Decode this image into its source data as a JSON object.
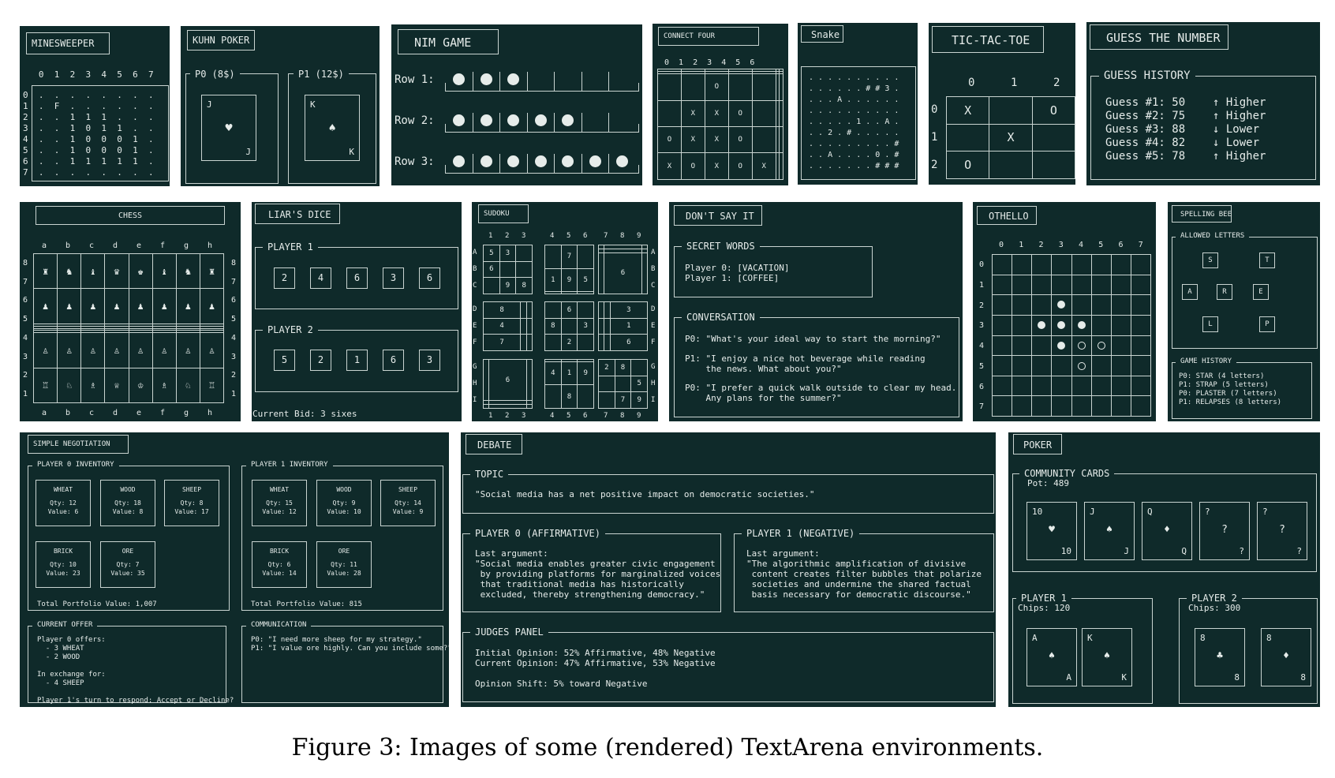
{
  "minesweeper": {
    "title": "MINESWEEPER",
    "col_header": "   0  1  2  3  4  5  6  7",
    "rows": [
      "0  .  .  .  .  .  .  .  .",
      "1  .  F  .  .  .  .  .  .",
      "2  .  .  1  1  1  .  .  .",
      "3  .  .  1  0  1  1  .  .",
      "4  .  .  1  0  0  0  1  .",
      "5  .  .  1  0  0  0  1  .",
      "6  .  .  1  1  1  1  1  .",
      "7  .  .  .  .  .  .  .  ."
    ]
  },
  "kuhn": {
    "title": "KUHN POKER",
    "p0_label": "P0 (8$)",
    "p1_label": "P1 (12$)",
    "p0_rank": "J",
    "p0_suit": "♥",
    "p1_rank": "K",
    "p1_suit": "♠"
  },
  "nim": {
    "title": "NIM GAME",
    "rows": [
      {
        "label": "Row 1:",
        "filled": 3,
        "slots": 7
      },
      {
        "label": "Row 2:",
        "filled": 5,
        "slots": 7
      },
      {
        "label": "Row 3:",
        "filled": 7,
        "slots": 7
      }
    ]
  },
  "connect_four": {
    "title": "CONNECT FOUR",
    "col_header": "0  1  2  3  4  5  6",
    "board": [
      [
        " ",
        " ",
        " ",
        " ",
        " ",
        " ",
        " "
      ],
      [
        " ",
        " ",
        " ",
        " ",
        " ",
        " ",
        " "
      ],
      [
        " ",
        " ",
        "O",
        " ",
        " ",
        " ",
        " "
      ],
      [
        " ",
        "X",
        "X",
        "O",
        " ",
        " ",
        " "
      ],
      [
        "O",
        "X",
        "X",
        "O",
        " ",
        " ",
        " "
      ],
      [
        "X",
        "O",
        "X",
        "O",
        "X",
        " ",
        " "
      ]
    ]
  },
  "snake": {
    "title": "Snake",
    "rows": [
      ". . . . . . . . . .",
      ". . . . . . # # 3 .",
      ". . . A . . . . . .",
      ". . . . . . . . . .",
      ". . . . . 1 . . A .",
      ". . 2 . # . . . . .",
      ". . . . . . . . . #",
      ". . A . . . . 0 . #",
      ". . . . . . . # # #"
    ]
  },
  "tictactoe": {
    "title": "TIC-TAC-TOE",
    "cols": [
      "0",
      "1",
      "2"
    ],
    "rows": [
      "0",
      "1",
      "2"
    ],
    "board": [
      [
        "X",
        "",
        "O"
      ],
      [
        "",
        "X",
        ""
      ],
      [
        "O",
        "",
        ""
      ]
    ]
  },
  "guess": {
    "title": "GUESS THE NUMBER",
    "history_label": "GUESS HISTORY",
    "entries": [
      {
        "guess": "Guess #1: 50",
        "hint": "↑ Higher"
      },
      {
        "guess": "Guess #2: 75",
        "hint": "↑ Higher"
      },
      {
        "guess": "Guess #3: 88",
        "hint": "↓ Lower"
      },
      {
        "guess": "Guess #4: 82",
        "hint": "↓ Lower"
      },
      {
        "guess": "Guess #5: 78",
        "hint": "↑ Higher"
      }
    ]
  },
  "chess": {
    "title": "CHESS",
    "files": [
      "a",
      "b",
      "c",
      "d",
      "e",
      "f",
      "g",
      "h"
    ],
    "ranks": [
      "8",
      "7",
      "6",
      "5",
      "4",
      "3",
      "2",
      "1"
    ],
    "board": [
      [
        "♜",
        "♞",
        "♝",
        "♛",
        "♚",
        "♝",
        "♞",
        "♜"
      ],
      [
        "♟",
        "♟",
        "♟",
        "♟",
        "♟",
        "♟",
        "♟",
        "♟"
      ],
      [
        "",
        "",
        "",
        "",
        "",
        "",
        "",
        ""
      ],
      [
        "",
        "",
        "",
        "",
        "",
        "",
        "",
        ""
      ],
      [
        "",
        "",
        "",
        "",
        "",
        "",
        "",
        ""
      ],
      [
        "",
        "",
        "",
        "",
        "",
        "",
        "",
        ""
      ],
      [
        "♙",
        "♙",
        "♙",
        "♙",
        "♙",
        "♙",
        "♙",
        "♙"
      ],
      [
        "♖",
        "♘",
        "♗",
        "♕",
        "♔",
        "♗",
        "♘",
        "♖"
      ]
    ]
  },
  "liars_dice": {
    "title": "LIAR'S DICE",
    "p1_label": "PLAYER 1",
    "p1_dice": [
      "2",
      "4",
      "6",
      "3",
      "6"
    ],
    "p2_label": "PLAYER 2",
    "p2_dice": [
      "5",
      "2",
      "1",
      "6",
      "3"
    ],
    "bid": "Current Bid: 3 sixes"
  },
  "sudoku": {
    "title": "SUDOKU",
    "cols": [
      "1",
      "2",
      "3",
      "4",
      "5",
      "6",
      "7",
      "8",
      "9"
    ],
    "rows": [
      "A",
      "B",
      "C",
      "D",
      "E",
      "F",
      "G",
      "H",
      "I"
    ],
    "grid": [
      [
        "5",
        "3",
        "",
        "",
        "7",
        "",
        "",
        "",
        ""
      ],
      [
        "6",
        "",
        "",
        "1",
        "9",
        "5",
        "",
        "",
        ""
      ],
      [
        "",
        "9",
        "8",
        "",
        "",
        "",
        "",
        "6",
        ""
      ],
      [
        "8",
        "",
        "",
        "",
        "6",
        "",
        "",
        "",
        "3"
      ],
      [
        "4",
        "",
        "",
        "8",
        "",
        "3",
        "",
        "",
        "1"
      ],
      [
        "7",
        "",
        "",
        "",
        "2",
        "",
        "",
        "",
        "6"
      ],
      [
        "",
        "6",
        "",
        "",
        "",
        "",
        "2",
        "8",
        ""
      ],
      [
        "",
        "",
        "",
        "4",
        "1",
        "9",
        "",
        "",
        "5"
      ],
      [
        "",
        "",
        "",
        "",
        "8",
        "",
        "",
        "7",
        "9"
      ]
    ]
  },
  "dont_say_it": {
    "title": "DON'T SAY IT",
    "secret_label": "SECRET WORDS",
    "secrets": [
      "Player 0: [VACATION]",
      "Player 1: [COFFEE]"
    ],
    "conversation_label": "CONVERSATION",
    "lines": [
      "P0: \"What's your ideal way to start the morning?\"",
      "P1: \"I enjoy a nice hot beverage while reading\n    the news. What about you?\"",
      "P0: \"I prefer a quick walk outside to clear my head.\n    Any plans for the summer?\""
    ]
  },
  "othello": {
    "title": "OTHELLO",
    "cols": [
      "0",
      "1",
      "2",
      "3",
      "4",
      "5",
      "6",
      "7"
    ],
    "rows": [
      "0",
      "1",
      "2",
      "3",
      "4",
      "5",
      "6",
      "7"
    ],
    "pieces": [
      {
        "r": 2,
        "c": 3,
        "color": "black"
      },
      {
        "r": 3,
        "c": 2,
        "color": "black"
      },
      {
        "r": 3,
        "c": 3,
        "color": "black"
      },
      {
        "r": 3,
        "c": 4,
        "color": "black"
      },
      {
        "r": 4,
        "c": 3,
        "color": "black"
      },
      {
        "r": 4,
        "c": 4,
        "color": "white"
      },
      {
        "r": 4,
        "c": 5,
        "color": "white"
      },
      {
        "r": 5,
        "c": 4,
        "color": "white"
      }
    ]
  },
  "spelling_bee": {
    "title": "SPELLING BEE",
    "allowed_label": "ALLOWED LETTERS",
    "letters": [
      "S",
      "T",
      "A",
      "R",
      "E",
      "L",
      "P"
    ],
    "history_label": "GAME HISTORY",
    "history": [
      "P0: STAR (4 letters)",
      "P1: STRAP (5 letters)",
      "P0: PLASTER (7 letters)",
      "P1: RELAPSES (8 letters)"
    ]
  },
  "negotiation": {
    "title": "SIMPLE NEGOTIATION",
    "p0_label": "PLAYER 0 INVENTORY",
    "p0_items": [
      {
        "name": "WHEAT",
        "qty": "Qty: 12",
        "value": "Value: 6"
      },
      {
        "name": "WOOD",
        "qty": "Qty: 18",
        "value": "Value: 8"
      },
      {
        "name": "SHEEP",
        "qty": "Qty: 8",
        "value": "Value: 17"
      },
      {
        "name": "BRICK",
        "qty": "Qty: 10",
        "value": "Value: 23"
      },
      {
        "name": "ORE",
        "qty": "Qty: 7",
        "value": "Value: 35"
      }
    ],
    "p0_total": "Total Portfolio Value: 1,007",
    "p1_label": "PLAYER 1 INVENTORY",
    "p1_items": [
      {
        "name": "WHEAT",
        "qty": "Qty: 15",
        "value": "Value: 12"
      },
      {
        "name": "WOOD",
        "qty": "Qty: 9",
        "value": "Value: 10"
      },
      {
        "name": "SHEEP",
        "qty": "Qty: 14",
        "value": "Value: 9"
      },
      {
        "name": "BRICK",
        "qty": "Qty: 6",
        "value": "Value: 14"
      },
      {
        "name": "ORE",
        "qty": "Qty: 11",
        "value": "Value: 28"
      }
    ],
    "p1_total": "Total Portfolio Value: 815",
    "offer_label": "CURRENT OFFER",
    "offer_text": "Player 0 offers:\n  - 3 WHEAT\n  - 2 WOOD\n\nIn exchange for:\n  - 4 SHEEP\n\nPlayer 1's turn to respond: Accept or Decline?",
    "comm_label": "COMMUNICATION",
    "comm_text": "P0: \"I need more sheep for my strategy.\"\nP1: \"I value ore highly. Can you include some?\""
  },
  "debate": {
    "title": "DEBATE",
    "topic_label": "TOPIC",
    "topic": "\"Social media has a net positive impact on democratic societies.\"",
    "p0_label": "PLAYER 0 (AFFIRMATIVE)",
    "p0_text": "Last argument:\n\"Social media enables greater civic engagement\n by providing platforms for marginalized voices\n that traditional media has historically\n excluded, thereby strengthening democracy.\"",
    "p1_label": "PLAYER 1 (NEGATIVE)",
    "p1_text": "Last argument:\n\"The algorithmic amplification of divisive\n content creates filter bubbles that polarize\n societies and undermine the shared factual\n basis necessary for democratic discourse.\"",
    "judges_label": "JUDGES PANEL",
    "judges_text": "Initial Opinion: 52% Affirmative, 48% Negative\nCurrent Opinion: 47% Affirmative, 53% Negative\n\nOpinion Shift: 5% toward Negative"
  },
  "poker": {
    "title": "POKER",
    "community_label": "COMMUNITY CARDS",
    "pot": "Pot: 489",
    "community": [
      {
        "rank": "10",
        "suit": "♥"
      },
      {
        "rank": "J",
        "suit": "♠"
      },
      {
        "rank": "Q",
        "suit": "♦"
      },
      {
        "rank": "?",
        "suit": "?"
      },
      {
        "rank": "?",
        "suit": "?"
      }
    ],
    "p1_label": "PLAYER 1",
    "p1_chips": "Chips: 120",
    "p1_cards": [
      {
        "rank": "A",
        "suit": "♠"
      },
      {
        "rank": "K",
        "suit": "♠"
      }
    ],
    "p2_label": "PLAYER 2",
    "p2_chips": "Chips: 300",
    "p2_cards": [
      {
        "rank": "8",
        "suit": "♣"
      },
      {
        "rank": "8",
        "suit": "♦"
      }
    ]
  },
  "caption": "Figure 3: Images of some (rendered) TextArena environments."
}
